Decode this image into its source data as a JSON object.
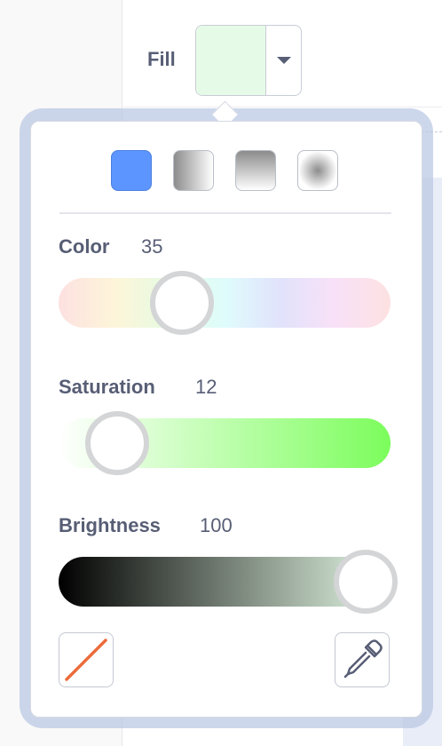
{
  "fill": {
    "label": "Fill",
    "swatch_color": "#e6fbe7"
  },
  "gradient_options": [
    {
      "icon": "solid-fill-icon",
      "selected": true
    },
    {
      "icon": "horizontal-gradient-icon",
      "selected": false
    },
    {
      "icon": "vertical-gradient-icon",
      "selected": false
    },
    {
      "icon": "radial-gradient-icon",
      "selected": false
    }
  ],
  "sliders": [
    {
      "label": "Color",
      "value": "35",
      "level": 0.35
    },
    {
      "label": "Saturation",
      "value": "12",
      "level": 0.12
    },
    {
      "label": "Brightness",
      "value": "100",
      "level": 1.0
    }
  ],
  "colors": {
    "accent": "#4c97ff",
    "text": "#575e75",
    "knob_border": "#d4d5d6",
    "no_fill_stroke": "#ec6b3a"
  },
  "tools": {
    "no_fill_icon": "no-fill-icon",
    "eyedropper_icon": "eyedropper-icon"
  }
}
